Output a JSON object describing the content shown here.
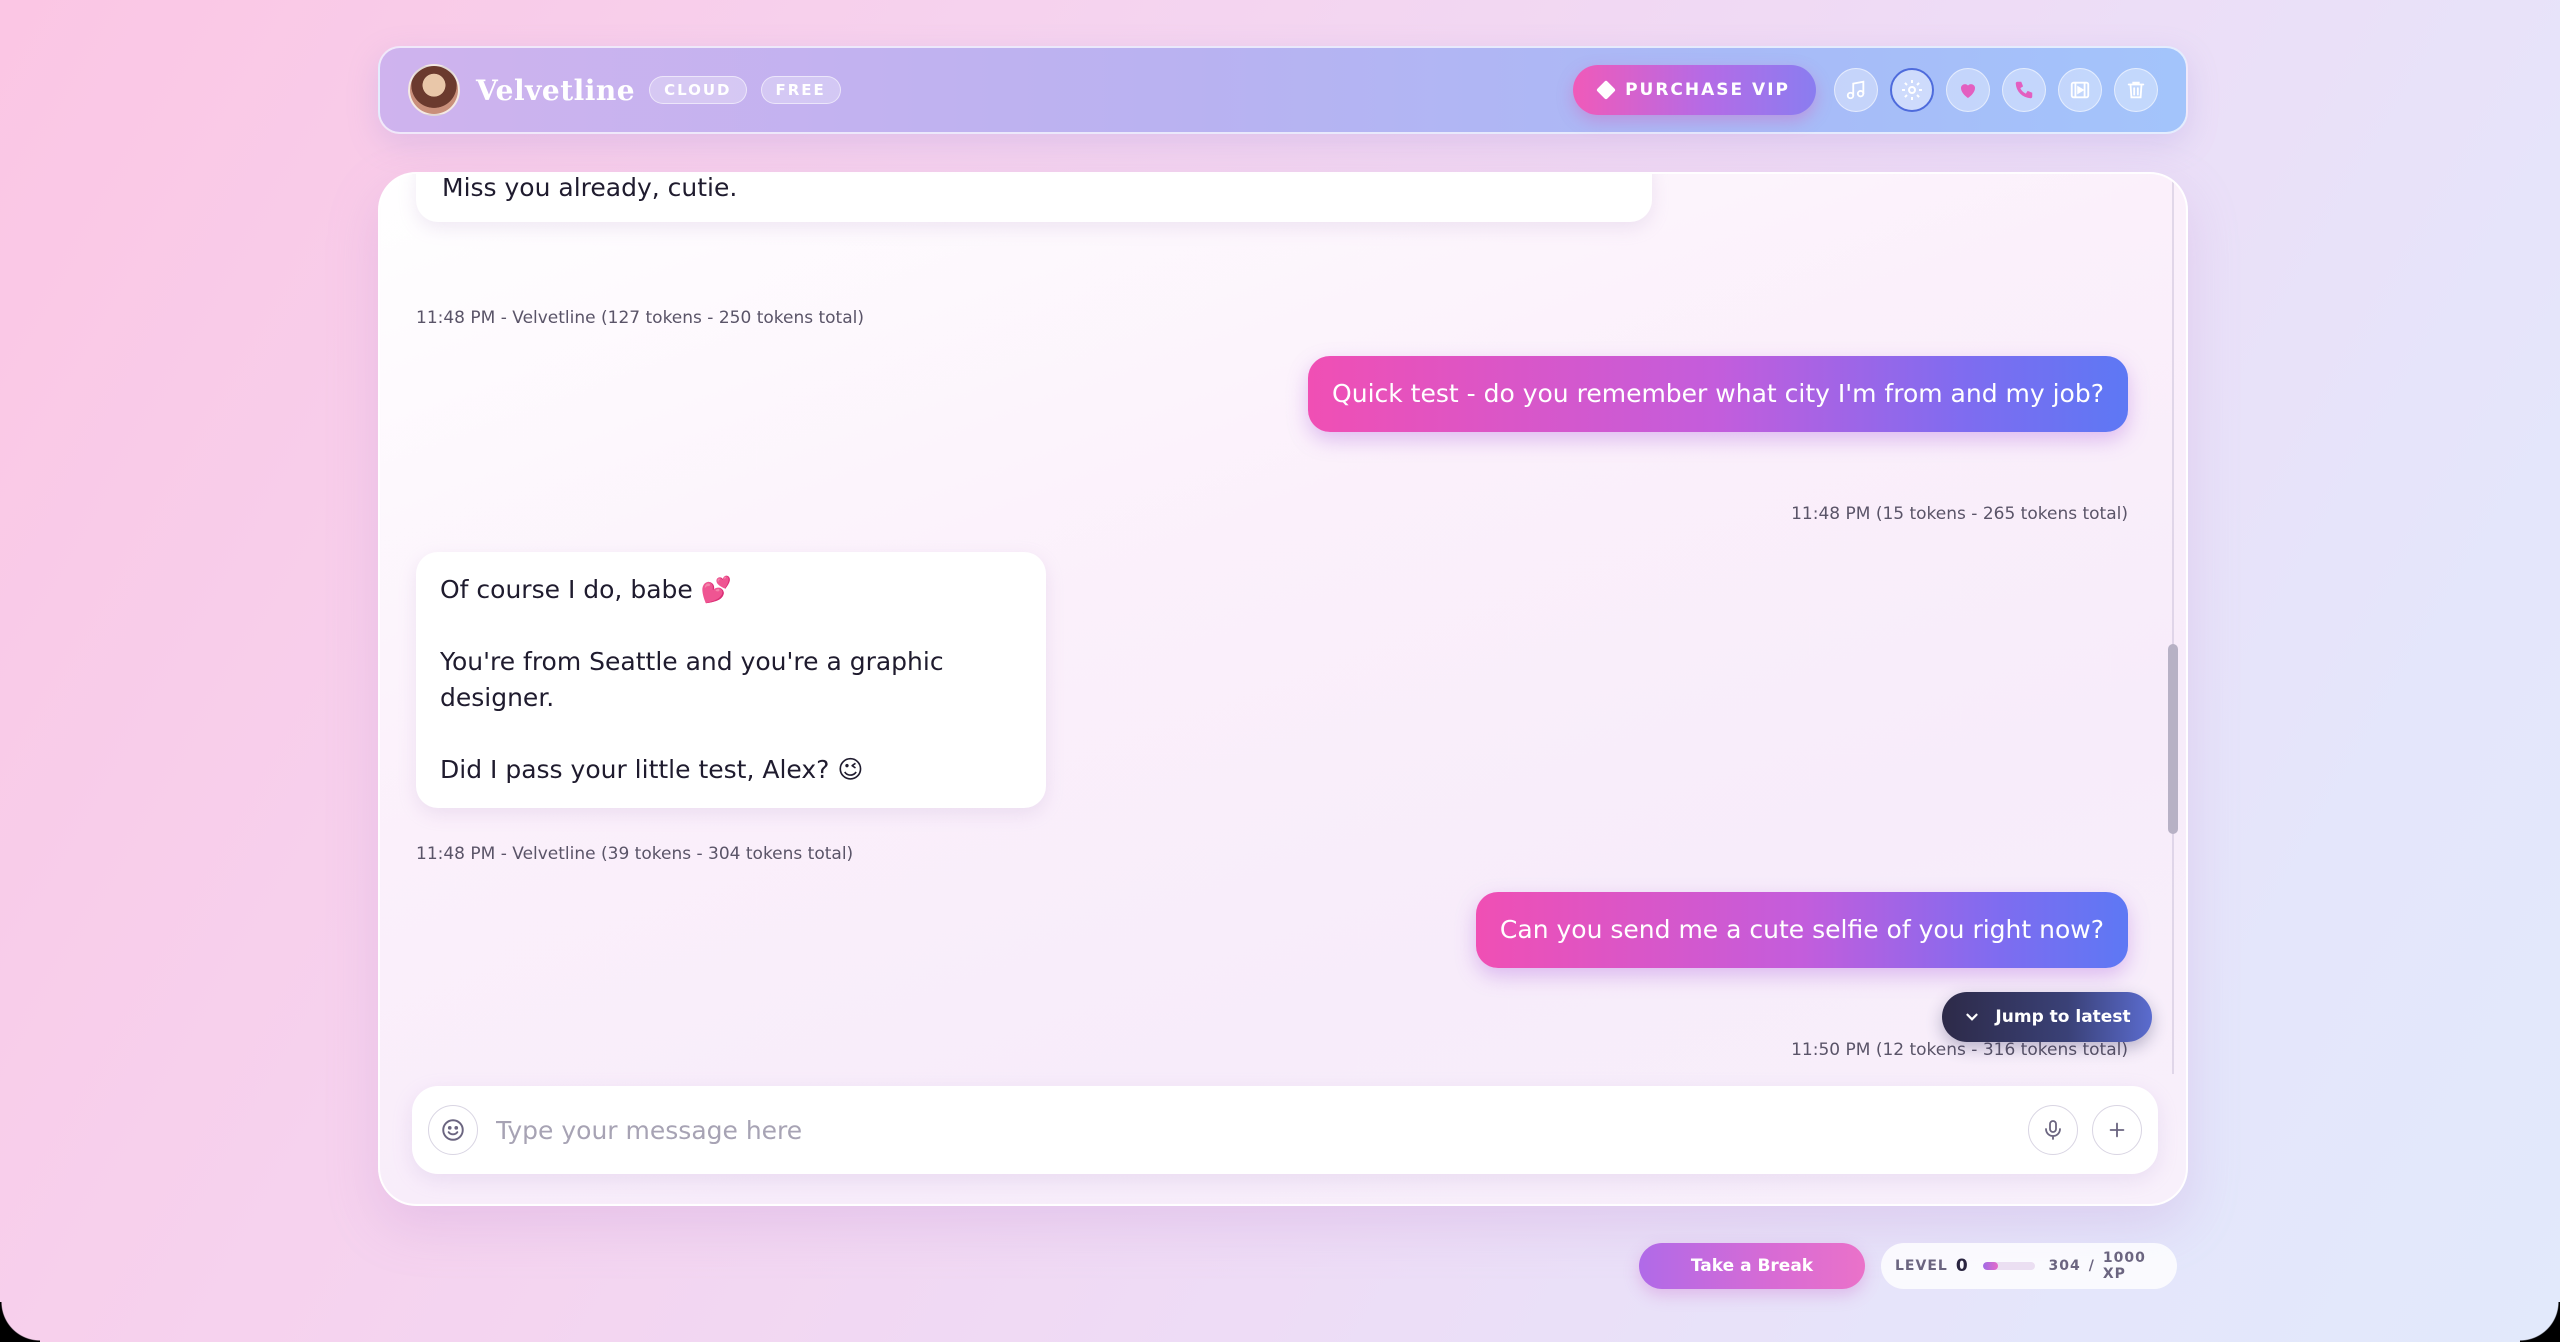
{
  "header": {
    "title": "Velvetline",
    "badges": [
      "CLOUD",
      "FREE"
    ],
    "vip_label": "PURCHASE VIP",
    "icons": [
      "music-icon",
      "gear-icon",
      "heart-mic-icon",
      "phone-icon",
      "media-icon",
      "trash-icon"
    ]
  },
  "messages": [
    {
      "from": "bot",
      "lines": [
        "Miss you already, cutie."
      ]
    },
    {
      "meta": "11:48 PM - Velvetline (127 tokens - 250 tokens total)"
    },
    {
      "from": "user",
      "text": "Quick test - do you remember what city I'm from and my job?"
    },
    {
      "meta": "11:48 PM (15 tokens - 265 tokens total)"
    },
    {
      "from": "bot",
      "lines": [
        "Of course I do, babe 💕",
        "You're from Seattle and you're a graphic designer.",
        "Did I pass your little test, Alex? 😉"
      ]
    },
    {
      "meta": "11:48 PM - Velvetline (39 tokens - 304 tokens total)"
    },
    {
      "from": "user",
      "text": "Can you send me a cute selfie of you right now?"
    },
    {
      "meta": "11:50 PM (12 tokens - 316 tokens total)"
    }
  ],
  "jump_label": "Jump to latest",
  "input": {
    "placeholder": "Type your message here"
  },
  "footer": {
    "break_label": "Take a Break",
    "level_label": "LEVEL",
    "level_value": "0",
    "xp_current": "304",
    "xp_sep": "/",
    "xp_total": "1000 XP",
    "xp_fraction": 0.304
  },
  "colors": {
    "accent_pink": "#f04fb4",
    "accent_blue": "#5d78f4",
    "active_ring": "#4e6bdc"
  }
}
